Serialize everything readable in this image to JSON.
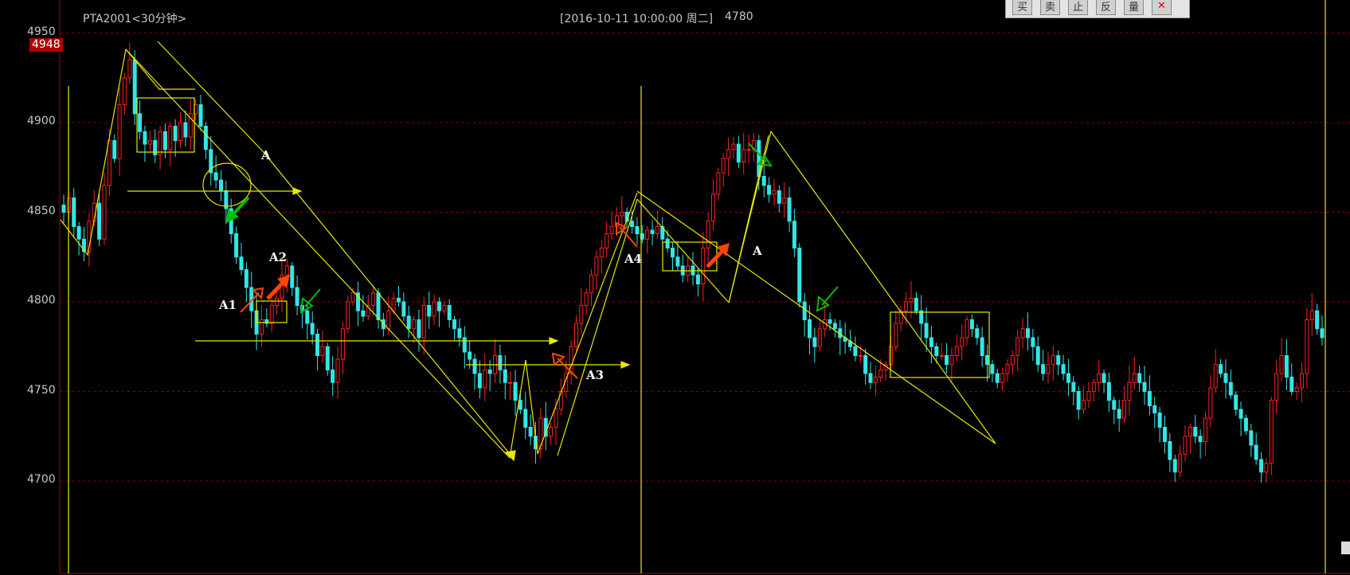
{
  "header": {
    "symbol_label": "PTA2001<30分钟>",
    "cursor_info": "[2016-10-11  10:00:00 周二]",
    "cursor_value": "4780"
  },
  "toolbar": {
    "buttons": [
      "买",
      "卖",
      "止",
      "反",
      "量",
      "✕"
    ]
  },
  "current_price": "4948",
  "annotations": [
    "A",
    "A1",
    "A2",
    "A3",
    "A4",
    "A"
  ],
  "colors": {
    "up": "#ff2020",
    "down": "#33e6e6",
    "drawing": "#e8e800",
    "grid": "#8b0000",
    "arrow_red": "#ff4500",
    "arrow_green": "#00c000"
  },
  "chart_data": {
    "type": "candlestick",
    "title": "PTA2001<30分钟>",
    "ylim": [
      4650,
      4960
    ],
    "yticks": [
      4700,
      4750,
      4800,
      4850,
      4900,
      4950
    ],
    "grid": true,
    "closes": [
      4850,
      4858,
      4842,
      4835,
      4828,
      4845,
      4855,
      4835,
      4865,
      4890,
      4880,
      4910,
      4925,
      4935,
      4905,
      4895,
      4888,
      4890,
      4882,
      4895,
      4885,
      4898,
      4890,
      4900,
      4892,
      4905,
      4910,
      4898,
      4885,
      4872,
      4868,
      4862,
      4852,
      4838,
      4825,
      4818,
      4808,
      4795,
      4782,
      4790,
      4788,
      4798,
      4802,
      4815,
      4820,
      4808,
      4798,
      4795,
      4788,
      4782,
      4770,
      4775,
      4762,
      4755,
      4768,
      4785,
      4800,
      4805,
      4795,
      4792,
      4798,
      4805,
      4790,
      4785,
      4795,
      4802,
      4800,
      4792,
      4785,
      4790,
      4780,
      4798,
      4792,
      4800,
      4795,
      4798,
      4790,
      4785,
      4780,
      4772,
      4768,
      4760,
      4752,
      4762,
      4760,
      4770,
      4762,
      4755,
      4755,
      4745,
      4740,
      4730,
      4725,
      4718,
      4735,
      4725,
      4730,
      4740,
      4750,
      4760,
      4775,
      4788,
      4798,
      4805,
      4815,
      4825,
      4830,
      4838,
      4842,
      4848,
      4850,
      4845,
      4842,
      4838,
      4835,
      4840,
      4838,
      4842,
      4835,
      4830,
      4825,
      4820,
      4815,
      4820,
      4815,
      4810,
      4830,
      4845,
      4860,
      4872,
      4880,
      4885,
      4888,
      4878,
      4885,
      4885,
      4890,
      4870,
      4865,
      4860,
      4862,
      4855,
      4858,
      4845,
      4830,
      4800,
      4790,
      4780,
      4775,
      4785,
      4790,
      4788,
      4785,
      4780,
      4778,
      4775,
      4770,
      4770,
      4760,
      4755,
      4758,
      4762,
      4765,
      4775,
      4788,
      4795,
      4800,
      4802,
      4795,
      4788,
      4780,
      4775,
      4770,
      4770,
      4765,
      4770,
      4775,
      4780,
      4790,
      4785,
      4780,
      4770,
      4765,
      4760,
      4755,
      4760,
      4765,
      4770,
      4780,
      4785,
      4780,
      4775,
      4765,
      4760,
      4765,
      4770,
      4765,
      4760,
      4755,
      4750,
      4740,
      4745,
      4750,
      4755,
      4760,
      4755,
      4745,
      4740,
      4735,
      4745,
      4755,
      4760,
      4755,
      4750,
      4742,
      4738,
      4730,
      4722,
      4712,
      4705,
      4715,
      4725,
      4730,
      4725,
      4722,
      4735,
      4752,
      4765,
      4760,
      4755,
      4748,
      4740,
      4735,
      4728,
      4720,
      4712,
      4705,
      4710,
      4745,
      4760,
      4770,
      4758,
      4750,
      4752,
      4760,
      4790,
      4795,
      4785,
      4780
    ]
  }
}
